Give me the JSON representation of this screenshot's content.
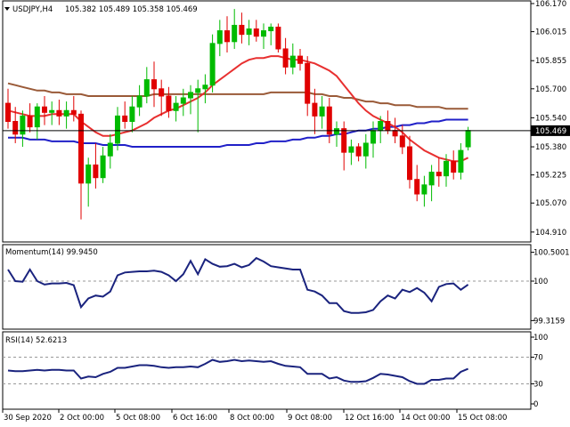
{
  "header": {
    "symbol_tf": "USDJPY,H4",
    "ohlc": "105.382 105.489 105.358 105.469"
  },
  "colors": {
    "bull": "#00bb00",
    "bear": "#e00000",
    "ma_fast": "#e83030",
    "ma_mid": "#2020c8",
    "ma_slow": "#9a5a38",
    "indicator_line": "#1a237e",
    "price_line": "#000000",
    "grid_dash": "#999999"
  },
  "chart_data": [
    {
      "type": "candlestick",
      "title": "USDJPY,H4",
      "ylim": [
        104.87,
        106.17
      ],
      "y_ticks": [
        "106.170",
        "106.015",
        "105.855",
        "105.700",
        "105.540",
        "105.380",
        "105.225",
        "105.070",
        "104.910"
      ],
      "current_price": "105.469",
      "x_tick_labels": [
        "30 Sep 2020",
        "2 Oct 00:00",
        "5 Oct 08:00",
        "6 Oct 16:00",
        "8 Oct 00:00",
        "9 Oct 08:00",
        "12 Oct 16:00",
        "14 Oct 00:00",
        "15 Oct 08:00"
      ],
      "candles": [
        [
          105.62,
          105.7,
          105.48,
          105.52
        ],
        [
          105.52,
          105.6,
          105.4,
          105.45
        ],
        [
          105.45,
          105.58,
          105.38,
          105.55
        ],
        [
          105.55,
          105.62,
          105.46,
          105.49
        ],
        [
          105.49,
          105.62,
          105.42,
          105.6
        ],
        [
          105.6,
          105.66,
          105.5,
          105.57
        ],
        [
          105.57,
          105.63,
          105.5,
          105.58
        ],
        [
          105.58,
          105.64,
          105.5,
          105.55
        ],
        [
          105.55,
          105.63,
          105.48,
          105.58
        ],
        [
          105.58,
          105.66,
          105.52,
          105.56
        ],
        [
          105.56,
          105.58,
          104.98,
          105.18
        ],
        [
          105.18,
          105.32,
          105.05,
          105.28
        ],
        [
          105.28,
          105.4,
          105.15,
          105.21
        ],
        [
          105.21,
          105.38,
          105.18,
          105.33
        ],
        [
          105.33,
          105.45,
          105.26,
          105.4
        ],
        [
          105.4,
          105.6,
          105.36,
          105.55
        ],
        [
          105.55,
          105.63,
          105.48,
          105.52
        ],
        [
          105.52,
          105.66,
          105.46,
          105.6
        ],
        [
          105.6,
          105.72,
          105.55,
          105.66
        ],
        [
          105.66,
          105.82,
          105.62,
          105.75
        ],
        [
          105.75,
          105.85,
          105.6,
          105.7
        ],
        [
          105.7,
          105.75,
          105.55,
          105.66
        ],
        [
          105.66,
          105.71,
          105.54,
          105.58
        ],
        [
          105.58,
          105.66,
          105.52,
          105.62
        ],
        [
          105.62,
          105.7,
          105.55,
          105.65
        ],
        [
          105.65,
          105.72,
          105.56,
          105.68
        ],
        [
          105.68,
          105.75,
          105.46,
          105.7
        ],
        [
          105.7,
          105.78,
          105.62,
          105.72
        ],
        [
          105.72,
          106.0,
          105.68,
          105.95
        ],
        [
          105.95,
          106.08,
          105.88,
          106.02
        ],
        [
          106.02,
          106.1,
          105.9,
          105.96
        ],
        [
          105.96,
          106.14,
          105.92,
          106.05
        ],
        [
          106.05,
          106.12,
          105.95,
          106.0
        ],
        [
          106.0,
          106.08,
          105.94,
          106.03
        ],
        [
          106.03,
          106.08,
          105.96,
          105.99
        ],
        [
          105.99,
          106.06,
          105.92,
          106.02
        ],
        [
          106.02,
          106.06,
          105.94,
          106.04
        ],
        [
          106.04,
          106.06,
          105.9,
          105.92
        ],
        [
          105.92,
          105.98,
          105.78,
          105.82
        ],
        [
          105.82,
          105.95,
          105.78,
          105.88
        ],
        [
          105.88,
          105.92,
          105.8,
          105.84
        ],
        [
          105.84,
          105.88,
          105.55,
          105.62
        ],
        [
          105.62,
          105.7,
          105.45,
          105.55
        ],
        [
          105.55,
          105.66,
          105.48,
          105.6
        ],
        [
          105.6,
          105.65,
          105.4,
          105.45
        ],
        [
          105.45,
          105.52,
          105.38,
          105.48
        ],
        [
          105.48,
          105.52,
          105.25,
          105.35
        ],
        [
          105.35,
          105.42,
          105.28,
          105.38
        ],
        [
          105.38,
          105.4,
          105.3,
          105.33
        ],
        [
          105.33,
          105.45,
          105.26,
          105.4
        ],
        [
          105.4,
          105.52,
          105.32,
          105.47
        ],
        [
          105.47,
          105.55,
          105.4,
          105.52
        ],
        [
          105.52,
          105.58,
          105.45,
          105.47
        ],
        [
          105.47,
          105.54,
          105.4,
          105.44
        ],
        [
          105.44,
          105.5,
          105.34,
          105.38
        ],
        [
          105.38,
          105.44,
          105.15,
          105.2
        ],
        [
          105.2,
          105.28,
          105.08,
          105.12
        ],
        [
          105.12,
          105.22,
          105.05,
          105.17
        ],
        [
          105.17,
          105.28,
          105.08,
          105.24
        ],
        [
          105.24,
          105.32,
          105.16,
          105.22
        ],
        [
          105.22,
          105.34,
          105.16,
          105.3
        ],
        [
          105.3,
          105.36,
          105.2,
          105.24
        ],
        [
          105.24,
          105.4,
          105.2,
          105.36
        ],
        [
          105.38,
          105.49,
          105.36,
          105.47
        ]
      ],
      "series": [
        {
          "name": "",
          "color_key": "ma_fast",
          "values": [
            105.58,
            105.57,
            105.56,
            105.55,
            105.55,
            105.55,
            105.56,
            105.56,
            105.56,
            105.56,
            105.52,
            105.49,
            105.46,
            105.44,
            105.44,
            105.45,
            105.46,
            105.47,
            105.49,
            105.51,
            105.54,
            105.56,
            105.58,
            105.59,
            105.61,
            105.63,
            105.65,
            105.68,
            105.72,
            105.75,
            105.78,
            105.81,
            105.84,
            105.86,
            105.87,
            105.87,
            105.88,
            105.88,
            105.87,
            105.86,
            105.86,
            105.85,
            105.84,
            105.82,
            105.8,
            105.77,
            105.72,
            105.67,
            105.62,
            105.58,
            105.55,
            105.53,
            105.51,
            105.49,
            105.46,
            105.42,
            105.39,
            105.36,
            105.34,
            105.32,
            105.31,
            105.3,
            105.3,
            105.32
          ]
        },
        {
          "name": "",
          "color_key": "ma_mid",
          "values": [
            105.43,
            105.43,
            105.43,
            105.42,
            105.42,
            105.42,
            105.41,
            105.41,
            105.41,
            105.41,
            105.4,
            105.4,
            105.4,
            105.39,
            105.39,
            105.39,
            105.39,
            105.38,
            105.38,
            105.38,
            105.38,
            105.38,
            105.38,
            105.38,
            105.38,
            105.38,
            105.38,
            105.38,
            105.38,
            105.38,
            105.39,
            105.39,
            105.39,
            105.39,
            105.4,
            105.4,
            105.41,
            105.41,
            105.41,
            105.42,
            105.42,
            105.43,
            105.43,
            105.44,
            105.44,
            105.45,
            105.45,
            105.46,
            105.47,
            105.47,
            105.48,
            105.48,
            105.49,
            105.49,
            105.5,
            105.5,
            105.51,
            105.51,
            105.52,
            105.52,
            105.53,
            105.53,
            105.53,
            105.53
          ]
        },
        {
          "name": "",
          "color_key": "ma_slow",
          "values": [
            105.73,
            105.72,
            105.71,
            105.7,
            105.69,
            105.69,
            105.68,
            105.68,
            105.67,
            105.67,
            105.67,
            105.66,
            105.66,
            105.66,
            105.66,
            105.66,
            105.66,
            105.66,
            105.66,
            105.66,
            105.67,
            105.67,
            105.67,
            105.67,
            105.67,
            105.67,
            105.67,
            105.67,
            105.67,
            105.67,
            105.67,
            105.67,
            105.67,
            105.67,
            105.67,
            105.67,
            105.68,
            105.68,
            105.68,
            105.68,
            105.68,
            105.68,
            105.67,
            105.67,
            105.66,
            105.66,
            105.65,
            105.65,
            105.64,
            105.63,
            105.63,
            105.62,
            105.62,
            105.61,
            105.61,
            105.61,
            105.6,
            105.6,
            105.6,
            105.6,
            105.59,
            105.59,
            105.59,
            105.59
          ]
        }
      ]
    },
    {
      "type": "line",
      "title": "Momentum(14) 99.9450",
      "ylim": [
        99.26,
        100.54
      ],
      "y_ticks": [
        "100.5001",
        "100",
        "99.3159"
      ],
      "level_lines": [
        100
      ],
      "series": [
        {
          "name": "Momentum(14)",
          "values": [
            100.2,
            100.0,
            99.99,
            100.2,
            100.0,
            99.94,
            99.96,
            99.96,
            99.97,
            99.93,
            99.55,
            99.7,
            99.75,
            99.73,
            99.82,
            100.1,
            100.15,
            100.16,
            100.17,
            100.17,
            100.18,
            100.16,
            100.1,
            100.0,
            100.12,
            100.35,
            100.12,
            100.38,
            100.3,
            100.25,
            100.26,
            100.3,
            100.24,
            100.28,
            100.4,
            100.34,
            100.26,
            100.24,
            100.22,
            100.2,
            100.2,
            99.85,
            99.82,
            99.75,
            99.62,
            99.62,
            99.48,
            99.45,
            99.45,
            99.46,
            99.5,
            99.65,
            99.75,
            99.7,
            99.85,
            99.81,
            99.88,
            99.8,
            99.65,
            99.9,
            99.95,
            99.96,
            99.85,
            99.94
          ]
        }
      ]
    },
    {
      "type": "line",
      "title": "RSI(14) 52.6213",
      "ylim": [
        0,
        100
      ],
      "y_ticks": [
        "100",
        "70",
        "30",
        "0"
      ],
      "level_lines": [
        70,
        30
      ],
      "series": [
        {
          "name": "RSI(14)",
          "values": [
            50,
            49,
            49,
            50,
            51,
            50,
            51,
            51,
            50,
            50,
            38,
            41,
            40,
            45,
            48,
            54,
            54,
            56,
            58,
            58,
            57,
            55,
            54,
            55,
            55,
            56,
            55,
            60,
            66,
            63,
            64,
            66,
            64,
            65,
            64,
            63,
            64,
            60,
            57,
            56,
            55,
            45,
            45,
            45,
            38,
            40,
            35,
            33,
            33,
            34,
            39,
            45,
            44,
            42,
            40,
            34,
            30,
            30,
            36,
            36,
            38,
            38,
            48,
            52.6
          ]
        }
      ]
    }
  ]
}
